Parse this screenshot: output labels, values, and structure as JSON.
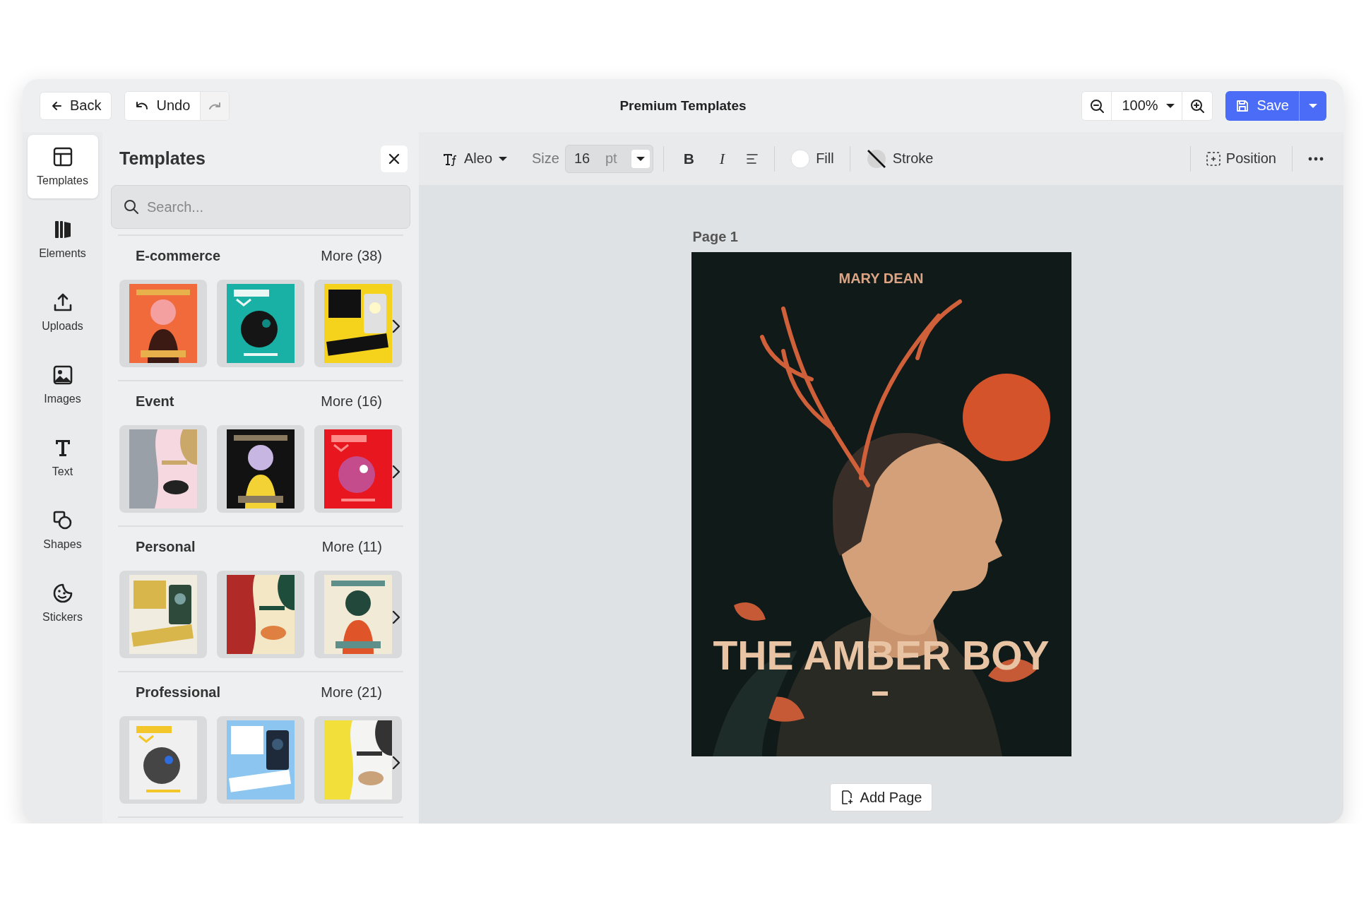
{
  "top_bar": {
    "back": "Back",
    "undo": "Undo",
    "title": "Premium Templates",
    "zoom": "100%",
    "save": "Save"
  },
  "rail": [
    {
      "label": "Templates",
      "selected": true
    },
    {
      "label": "Elements",
      "selected": false
    },
    {
      "label": "Uploads",
      "selected": false
    },
    {
      "label": "Images",
      "selected": false
    },
    {
      "label": "Text",
      "selected": false
    },
    {
      "label": "Shapes",
      "selected": false
    },
    {
      "label": "Stickers",
      "selected": false
    }
  ],
  "panel": {
    "title": "Templates",
    "search": {
      "placeholder": "Search..."
    },
    "sections": [
      {
        "name": "E-commerce",
        "more": "More (38)"
      },
      {
        "name": "Event",
        "more": "More (16)"
      },
      {
        "name": "Personal",
        "more": "More (11)"
      },
      {
        "name": "Professional",
        "more": "More (21)"
      }
    ]
  },
  "toolbar": {
    "font": "Aleo",
    "size_label": "Size",
    "size": "16",
    "unit": "pt",
    "bold": "B",
    "italic": "I",
    "fill": "Fill",
    "stroke": "Stroke",
    "position": "Position"
  },
  "canvas": {
    "page_label": "Page 1",
    "poster": {
      "author": "MARY DEAN",
      "title": "THE AMBER BOY"
    },
    "add_page": "Add Page"
  }
}
